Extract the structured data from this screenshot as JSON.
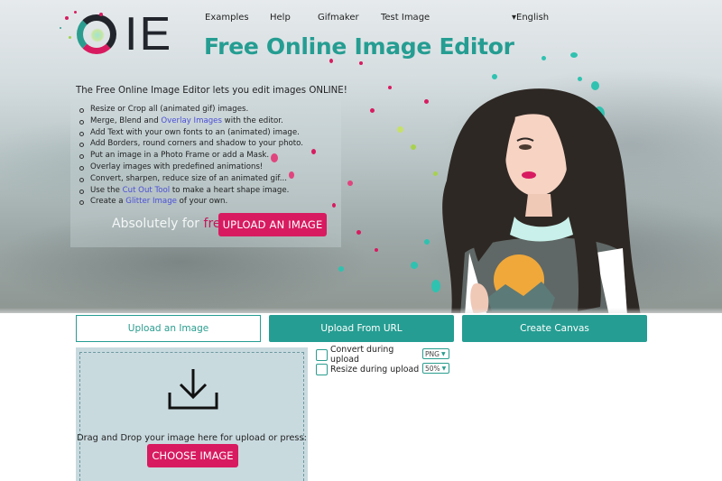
{
  "logo": {
    "text": "IE"
  },
  "nav": {
    "items": [
      {
        "label": "Examples"
      },
      {
        "label": "Help"
      },
      {
        "label": "Gifmaker"
      },
      {
        "label": "Test Image"
      }
    ],
    "language": "▾English"
  },
  "hero": {
    "title": "Free Online Image Editor",
    "intro": "The Free Online Image Editor lets you edit images ONLINE!",
    "features": [
      {
        "before": "Resize or Crop all (animated gif) images.",
        "link": "",
        "after": ""
      },
      {
        "before": "Merge, Blend and ",
        "link": "Overlay Images",
        "after": " with the editor."
      },
      {
        "before": "Add Text with your own fonts to an (animated) image.",
        "link": "",
        "after": ""
      },
      {
        "before": "Add Borders, round corners and shadow to your photo.",
        "link": "",
        "after": ""
      },
      {
        "before": "Put an image in a Photo Frame or add a Mask.",
        "link": "",
        "after": ""
      },
      {
        "before": "Overlay images with predefined animations!",
        "link": "",
        "after": ""
      },
      {
        "before": "Convert, sharpen, reduce size of an animated gif...",
        "link": "",
        "after": ""
      },
      {
        "before": "Use the ",
        "link": "Cut Out Tool",
        "after": " to make a heart shape image."
      },
      {
        "before": "Create a ",
        "link": "Glitter Image",
        "after": " of your own."
      }
    ],
    "absolutely": "Absolutely for ",
    "free": "free",
    "upload_button": "UPLOAD AN IMAGE"
  },
  "tabs": [
    {
      "label": "Upload an Image",
      "active": true
    },
    {
      "label": "Upload From URL",
      "active": false
    },
    {
      "label": "Create Canvas",
      "active": false
    }
  ],
  "dropzone": {
    "icon": "download-icon",
    "text": "Drag and Drop your image here for upload or press:",
    "button": "CHOOSE IMAGE"
  },
  "options": [
    {
      "label": "Convert during upload",
      "checked": false,
      "select_value": "PNG"
    },
    {
      "label": "Resize during upload",
      "checked": false,
      "select_value": "50%"
    }
  ],
  "colors": {
    "accent_teal": "#259d92",
    "accent_pink": "#d81b60",
    "link_blue": "#4a4fd6"
  }
}
